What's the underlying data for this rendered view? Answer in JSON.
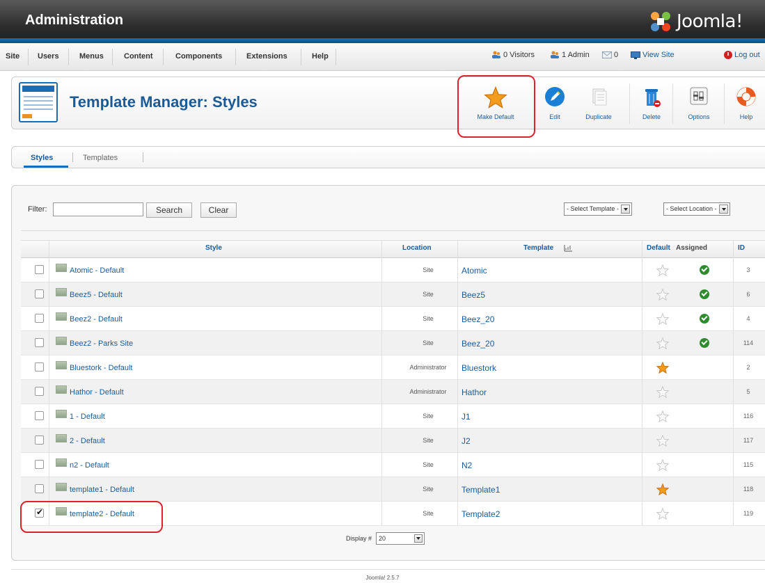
{
  "header": {
    "title": "Administration",
    "logo_text": "Joomla!"
  },
  "menu": {
    "items": [
      "Site",
      "Users",
      "Menus",
      "Content",
      "Components",
      "Extensions",
      "Help"
    ],
    "status": {
      "visitors": "0 Visitors",
      "admins": "1 Admin",
      "messages": "0",
      "view_site": "View Site",
      "logout": "Log out"
    }
  },
  "toolbar": {
    "page_title": "Template Manager: Styles",
    "buttons": {
      "make_default": "Make Default",
      "edit": "Edit",
      "duplicate": "Duplicate",
      "delete": "Delete",
      "options": "Options",
      "help": "Help"
    }
  },
  "tabs": {
    "styles": "Styles",
    "templates": "Templates"
  },
  "filter": {
    "label": "Filter:",
    "value": "",
    "search_label": "Search",
    "clear_label": "Clear",
    "select_template": "- Select Template -",
    "select_location": "- Select Location -"
  },
  "table": {
    "headers": {
      "style": "Style",
      "location": "Location",
      "template": "Template",
      "default": "Default",
      "assigned": "Assigned",
      "id": "ID"
    },
    "rows": [
      {
        "style": "Atomic - Default",
        "location": "Site",
        "template": "Atomic",
        "default": false,
        "assigned": true,
        "id": "3",
        "checked": false
      },
      {
        "style": "Beez5 - Default",
        "location": "Site",
        "template": "Beez5",
        "default": false,
        "assigned": true,
        "id": "6",
        "checked": false
      },
      {
        "style": "Beez2 - Default",
        "location": "Site",
        "template": "Beez_20",
        "default": false,
        "assigned": true,
        "id": "4",
        "checked": false
      },
      {
        "style": "Beez2 - Parks Site",
        "location": "Site",
        "template": "Beez_20",
        "default": false,
        "assigned": true,
        "id": "114",
        "checked": false
      },
      {
        "style": "Bluestork - Default",
        "location": "Administrator",
        "template": "Bluestork",
        "default": true,
        "assigned": false,
        "id": "2",
        "checked": false
      },
      {
        "style": "Hathor - Default",
        "location": "Administrator",
        "template": "Hathor",
        "default": false,
        "assigned": false,
        "id": "5",
        "checked": false
      },
      {
        "style": "1 - Default",
        "location": "Site",
        "template": "J1",
        "default": false,
        "assigned": false,
        "id": "116",
        "checked": false
      },
      {
        "style": "2 - Default",
        "location": "Site",
        "template": "J2",
        "default": false,
        "assigned": false,
        "id": "117",
        "checked": false
      },
      {
        "style": "n2 - Default",
        "location": "Site",
        "template": "N2",
        "default": false,
        "assigned": false,
        "id": "115",
        "checked": false
      },
      {
        "style": "template1 - Default",
        "location": "Site",
        "template": "Template1",
        "default": true,
        "assigned": false,
        "id": "118",
        "checked": false
      },
      {
        "style": "template2 - Default",
        "location": "Site",
        "template": "Template2",
        "default": false,
        "assigned": false,
        "id": "119",
        "checked": true
      }
    ]
  },
  "pagination": {
    "display_label": "Display #",
    "display_value": "20"
  },
  "footer": {
    "version": "Joomla! 2.5.7"
  },
  "colors": {
    "link": "#1a5a96",
    "highlight": "#e0202a",
    "star_active": "#f29b1d",
    "assigned": "#2e8b2e"
  }
}
